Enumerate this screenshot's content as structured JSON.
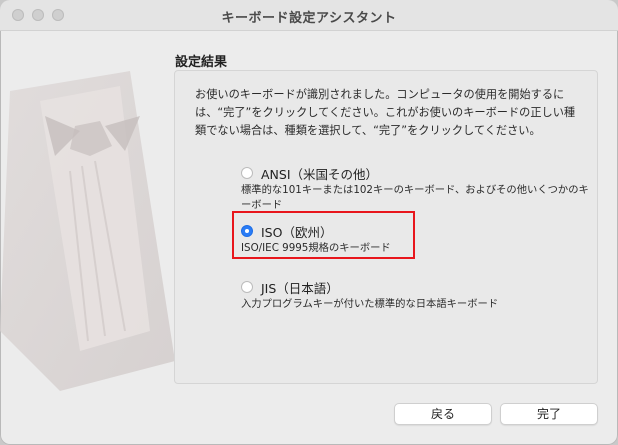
{
  "window": {
    "title": "キーボード設定アシスタント"
  },
  "section": {
    "title": "設定結果"
  },
  "description": "お使いのキーボードが識別されました。コンピュータの使用を開始するには、“完了”をクリックしてください。これがお使いのキーボードの正しい種類でない場合は、種類を選択して、“完了”をクリックしてください。",
  "options": [
    {
      "label": "ANSI（米国その他）",
      "description": "標準的な101キーまたは102キーのキーボード、およびその他いくつかのキーボード",
      "selected": false
    },
    {
      "label": "ISO（欧州）",
      "description": "ISO/IEC 9995規格のキーボード",
      "selected": true
    },
    {
      "label": "JIS（日本語）",
      "description": "入力プログラムキーが付いた標準的な日本語キーボード",
      "selected": false
    }
  ],
  "buttons": {
    "back": "戻る",
    "done": "完了"
  },
  "colors": {
    "accent": "#2a7cf6",
    "highlight_border": "#e8161c",
    "window_bg": "#ececec"
  },
  "icons": {
    "illustration": "tuxedo-illustration"
  }
}
